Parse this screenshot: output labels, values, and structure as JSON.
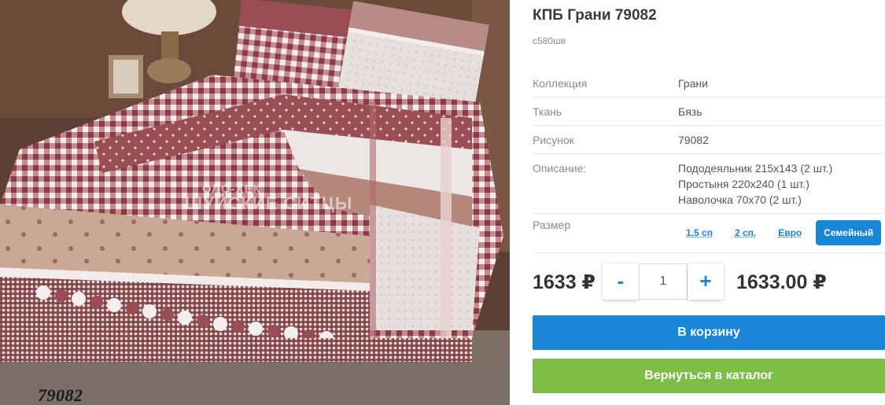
{
  "product": {
    "title": "КПБ Грани 79082",
    "sku": "с580шв",
    "image_code": "79082",
    "watermark_line1": "ОЛО-ХЕК",
    "watermark_line2": "ШУЙСКИЕ СИТЦЫ"
  },
  "properties": [
    {
      "label": "Коллекция",
      "value": "Грани"
    },
    {
      "label": "Ткань",
      "value": "Бязь"
    },
    {
      "label": "Рисунок",
      "value": "79082"
    }
  ],
  "description": {
    "label": "Описание:",
    "lines": [
      "Пододеяльник 215х143 (2 шт.)",
      "Простыня 220х240 (1 шт.)",
      "Наволочка 70х70 (2 шт.)"
    ]
  },
  "size": {
    "label": "Размер",
    "options": [
      "1,5 сп",
      "2 сп.",
      "Евро",
      "Семейный"
    ],
    "selected": "Семейный"
  },
  "price": {
    "unit_price": "1633 ₽",
    "minus": "-",
    "plus": "+",
    "quantity": "1",
    "total": "1633.00 ₽"
  },
  "buttons": {
    "cart": "В корзину",
    "back": "Вернуться в каталог"
  },
  "colors": {
    "accent_blue": "#1a86d8",
    "accent_green": "#7cbd45",
    "burgundy": "#9a4d54",
    "beige": "#c9a895"
  }
}
